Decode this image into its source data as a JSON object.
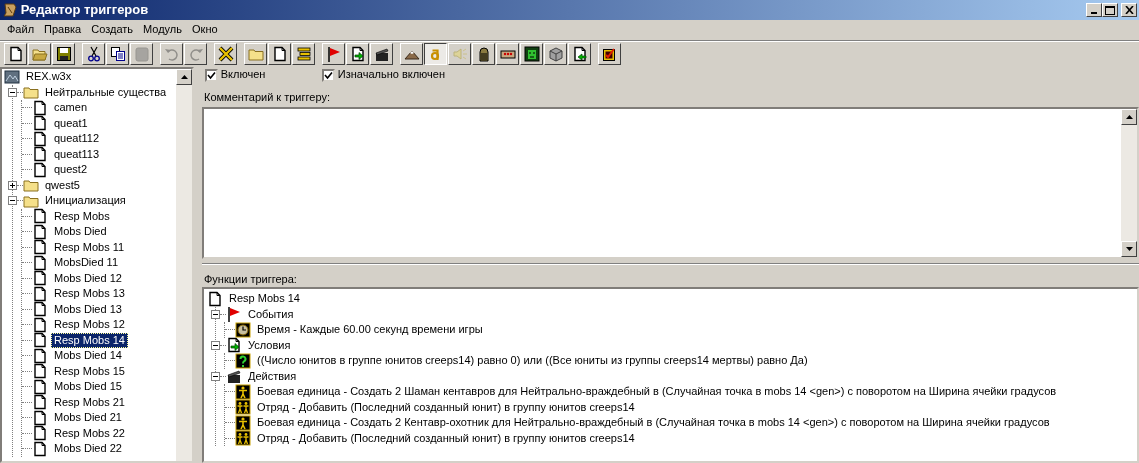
{
  "window": {
    "title": "Редактор триггеров"
  },
  "menu": [
    "Файл",
    "Правка",
    "Создать",
    "Модуль",
    "Окно"
  ],
  "toolbar": [
    [
      {
        "kind": "new",
        "disabled": false,
        "pressed": false
      },
      {
        "kind": "open",
        "disabled": false,
        "pressed": false
      },
      {
        "kind": "save",
        "disabled": false,
        "pressed": false
      }
    ],
    [
      {
        "kind": "cut",
        "disabled": false,
        "pressed": false
      },
      {
        "kind": "copy",
        "disabled": false,
        "pressed": false
      },
      {
        "kind": "paste",
        "disabled": true,
        "pressed": false
      }
    ],
    [
      {
        "kind": "undo",
        "disabled": true,
        "pressed": false
      },
      {
        "kind": "redo",
        "disabled": true,
        "pressed": false
      }
    ],
    [
      {
        "kind": "delete",
        "disabled": false,
        "pressed": false
      }
    ],
    [
      {
        "kind": "category",
        "disabled": false,
        "pressed": false
      },
      {
        "kind": "trigger",
        "disabled": false,
        "pressed": false
      },
      {
        "kind": "comment",
        "disabled": false,
        "pressed": false
      }
    ],
    [
      {
        "kind": "event",
        "disabled": false,
        "pressed": false
      },
      {
        "kind": "condition",
        "disabled": false,
        "pressed": false
      },
      {
        "kind": "action",
        "disabled": false,
        "pressed": false
      }
    ],
    [
      {
        "kind": "terrain",
        "disabled": false,
        "pressed": false
      },
      {
        "kind": "text",
        "disabled": false,
        "pressed": true
      },
      {
        "kind": "sound",
        "disabled": true,
        "pressed": false
      },
      {
        "kind": "statue",
        "disabled": false,
        "pressed": false
      },
      {
        "kind": "panel",
        "disabled": false,
        "pressed": false
      },
      {
        "kind": "face",
        "disabled": false,
        "pressed": false
      },
      {
        "kind": "cube",
        "disabled": false,
        "pressed": false
      },
      {
        "kind": "import",
        "disabled": false,
        "pressed": false
      }
    ],
    [
      {
        "kind": "test",
        "disabled": false,
        "pressed": false
      }
    ]
  ],
  "tree": {
    "root": {
      "label": "REX.w3x",
      "children": [
        {
          "kind": "folder",
          "label": "Нейтральные существа",
          "expanded": true,
          "selected": false,
          "children": [
            {
              "kind": "trigger",
              "label": "camen",
              "selected": false
            },
            {
              "kind": "trigger",
              "label": "queat1",
              "selected": false
            },
            {
              "kind": "trigger",
              "label": "queat112",
              "selected": false
            },
            {
              "kind": "trigger",
              "label": "queat113",
              "selected": false
            },
            {
              "kind": "trigger",
              "label": "quest2",
              "selected": false
            }
          ]
        },
        {
          "kind": "folder",
          "label": "qwest5",
          "expanded": false,
          "selected": false
        },
        {
          "kind": "folder",
          "label": "Инициализация",
          "expanded": true,
          "selected": false,
          "children": [
            {
              "kind": "trigger",
              "label": "Resp Mobs",
              "selected": false
            },
            {
              "kind": "trigger",
              "label": "Mobs Died",
              "selected": false
            },
            {
              "kind": "trigger",
              "label": "Resp Mobs 11",
              "selected": false
            },
            {
              "kind": "trigger",
              "label": "MobsDied 11",
              "selected": false
            },
            {
              "kind": "trigger",
              "label": "Mobs Died 12",
              "selected": false
            },
            {
              "kind": "trigger",
              "label": "Resp Mobs 13",
              "selected": false
            },
            {
              "kind": "trigger",
              "label": "Mobs Died 13",
              "selected": false
            },
            {
              "kind": "trigger",
              "label": "Resp Mobs 12",
              "selected": false
            },
            {
              "kind": "trigger",
              "label": "Resp Mobs 14",
              "selected": true
            },
            {
              "kind": "trigger",
              "label": "Mobs Died 14",
              "selected": false
            },
            {
              "kind": "trigger",
              "label": "Resp Mobs 15",
              "selected": false
            },
            {
              "kind": "trigger",
              "label": "Mobs Died 15",
              "selected": false
            },
            {
              "kind": "trigger",
              "label": "Resp Mobs 21",
              "selected": false
            },
            {
              "kind": "trigger",
              "label": "Mobs Died 21",
              "selected": false
            },
            {
              "kind": "trigger",
              "label": "Resp Mobs 22",
              "selected": false
            },
            {
              "kind": "trigger",
              "label": "Mobs Died 22",
              "selected": false
            }
          ]
        }
      ]
    }
  },
  "trigger": {
    "enabled": {
      "label": "Включен",
      "checked": true
    },
    "initially_on": {
      "label": "Изначально включен",
      "checked": true
    },
    "comment_label": "Комментарий к триггеру:",
    "functions_label": "Функции триггера:",
    "functions": {
      "label": "Resp Mobs 14",
      "children": [
        {
          "kind": "events",
          "label": "События",
          "expanded": true,
          "children": [
            {
              "kind": "clock",
              "label": "Время - Каждые 60.00 секунд времени игры"
            }
          ]
        },
        {
          "kind": "conditions",
          "label": "Условия",
          "expanded": true,
          "children": [
            {
              "kind": "question",
              "label": "((Число юнитов в группе юнитов creeps14) равно 0) или ((Все юниты из группы creeps14 мертвы) равно Да)"
            }
          ]
        },
        {
          "kind": "actions",
          "label": "Действия",
          "expanded": true,
          "children": [
            {
              "kind": "unit",
              "label": "Боевая единица - Создать 2 Шаман кентавров для Нейтрально-враждебный в (Случайная точка в mobs 14 <gen>) с поворотом на Ширина ячейки градусов"
            },
            {
              "kind": "group",
              "label": "Отряд - Добавить (Последний созданный юнит) в группу юнитов creeps14"
            },
            {
              "kind": "unit",
              "label": "Боевая единица - Создать 2 Кентавр-охотник для Нейтрально-враждебный в (Случайная точка в mobs 14 <gen>) с поворотом на Ширина ячейки градусов"
            },
            {
              "kind": "group",
              "label": "Отряд - Добавить (Последний созданный юнит) в группу юнитов creeps14"
            }
          ]
        }
      ]
    }
  }
}
